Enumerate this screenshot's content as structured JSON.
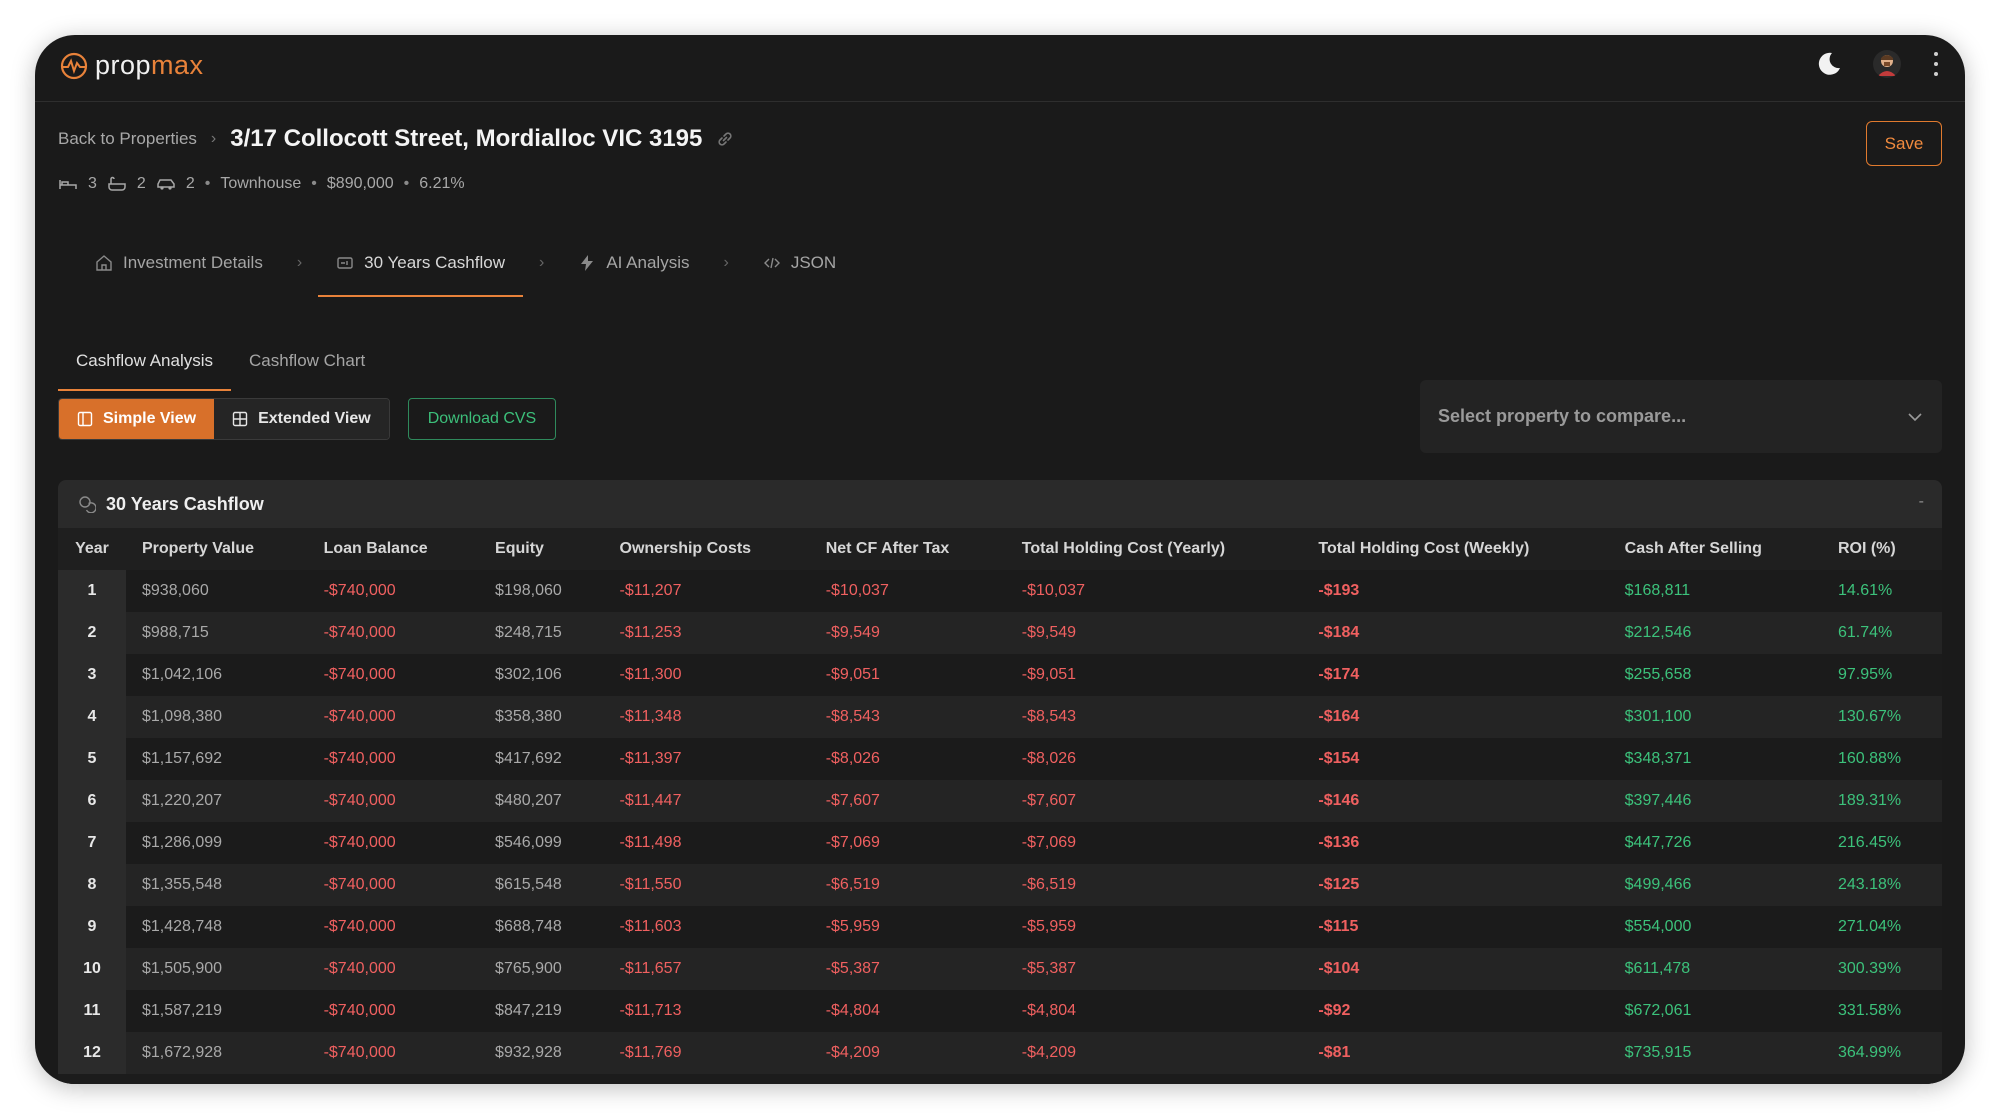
{
  "app": {
    "logo_prefix": "prop",
    "logo_suffix": "max",
    "accent": "#e8823a"
  },
  "header": {
    "back_label": "Back to Properties",
    "title": "3/17 Collocott Street, Mordialloc VIC 3195",
    "save_label": "Save",
    "beds": "3",
    "baths": "2",
    "cars": "2",
    "type": "Townhouse",
    "price": "$890,000",
    "yield": "6.21%"
  },
  "main_tabs": [
    {
      "label": "Investment Details",
      "icon": "home-icon"
    },
    {
      "label": "30 Years Cashflow",
      "icon": "cashflow-icon"
    },
    {
      "label": "AI Analysis",
      "icon": "bolt-icon"
    },
    {
      "label": "JSON",
      "icon": "code-icon"
    }
  ],
  "sub_tabs": [
    {
      "label": "Cashflow Analysis"
    },
    {
      "label": "Cashflow Chart"
    }
  ],
  "views": {
    "simple": "Simple View",
    "extended": "Extended View",
    "download": "Download CVS"
  },
  "compare": {
    "placeholder": "Select property to compare..."
  },
  "panel": {
    "title": "30 Years Cashflow",
    "collapse": "-"
  },
  "table": {
    "columns": [
      "Year",
      "Property Value",
      "Loan Balance",
      "Equity",
      "Ownership Costs",
      "Net CF After Tax",
      "Total Holding Cost (Yearly)",
      "Total Holding Cost (Weekly)",
      "Cash After Selling",
      "ROI (%)"
    ],
    "rows": [
      [
        "1",
        "$938,060",
        "-$740,000",
        "$198,060",
        "-$11,207",
        "-$10,037",
        "-$10,037",
        "-$193",
        "$168,811",
        "14.61%"
      ],
      [
        "2",
        "$988,715",
        "-$740,000",
        "$248,715",
        "-$11,253",
        "-$9,549",
        "-$9,549",
        "-$184",
        "$212,546",
        "61.74%"
      ],
      [
        "3",
        "$1,042,106",
        "-$740,000",
        "$302,106",
        "-$11,300",
        "-$9,051",
        "-$9,051",
        "-$174",
        "$255,658",
        "97.95%"
      ],
      [
        "4",
        "$1,098,380",
        "-$740,000",
        "$358,380",
        "-$11,348",
        "-$8,543",
        "-$8,543",
        "-$164",
        "$301,100",
        "130.67%"
      ],
      [
        "5",
        "$1,157,692",
        "-$740,000",
        "$417,692",
        "-$11,397",
        "-$8,026",
        "-$8,026",
        "-$154",
        "$348,371",
        "160.88%"
      ],
      [
        "6",
        "$1,220,207",
        "-$740,000",
        "$480,207",
        "-$11,447",
        "-$7,607",
        "-$7,607",
        "-$146",
        "$397,446",
        "189.31%"
      ],
      [
        "7",
        "$1,286,099",
        "-$740,000",
        "$546,099",
        "-$11,498",
        "-$7,069",
        "-$7,069",
        "-$136",
        "$447,726",
        "216.45%"
      ],
      [
        "8",
        "$1,355,548",
        "-$740,000",
        "$615,548",
        "-$11,550",
        "-$6,519",
        "-$6,519",
        "-$125",
        "$499,466",
        "243.18%"
      ],
      [
        "9",
        "$1,428,748",
        "-$740,000",
        "$688,748",
        "-$11,603",
        "-$5,959",
        "-$5,959",
        "-$115",
        "$554,000",
        "271.04%"
      ],
      [
        "10",
        "$1,505,900",
        "-$740,000",
        "$765,900",
        "-$11,657",
        "-$5,387",
        "-$5,387",
        "-$104",
        "$611,478",
        "300.39%"
      ],
      [
        "11",
        "$1,587,219",
        "-$740,000",
        "$847,219",
        "-$11,713",
        "-$4,804",
        "-$4,804",
        "-$92",
        "$672,061",
        "331.58%"
      ],
      [
        "12",
        "$1,672,928",
        "-$740,000",
        "$932,928",
        "-$11,769",
        "-$4,209",
        "-$4,209",
        "-$81",
        "$735,915",
        "364.99%"
      ]
    ]
  }
}
